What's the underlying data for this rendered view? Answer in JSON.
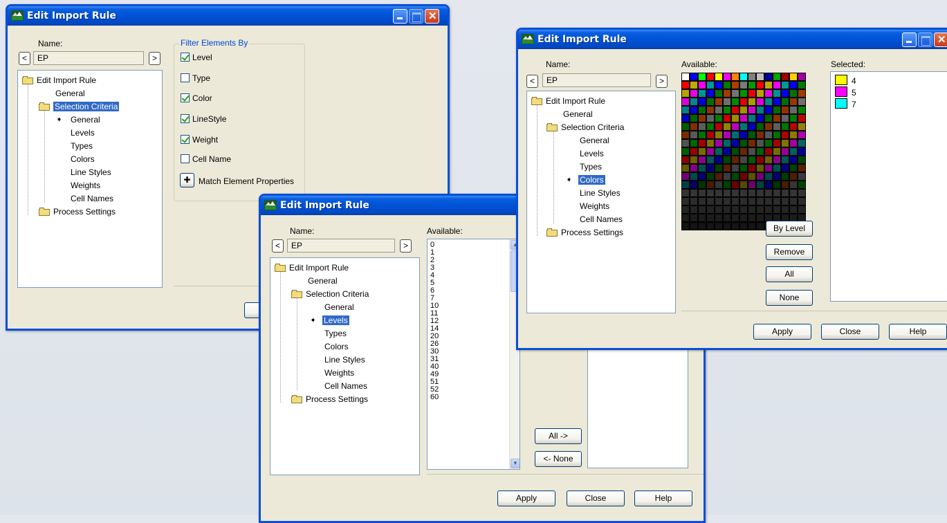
{
  "colors": {
    "accent": "#316ac5",
    "titlebar": "#0052d6",
    "dialog_bg": "#ece9d8"
  },
  "window1": {
    "title": "Edit Import Rule",
    "name_label": "Name:",
    "name_value": "EP",
    "prev": "<",
    "next": ">",
    "tree": {
      "root": "Edit Import Rule",
      "general": "General",
      "selection": "Selection Criteria",
      "children": [
        "General",
        "Levels",
        "Types",
        "Colors",
        "Line Styles",
        "Weights",
        "Cell Names"
      ],
      "process": "Process Settings"
    },
    "filter_title": "Filter Elements By",
    "filters": [
      {
        "label": "Level",
        "checked": true
      },
      {
        "label": "Type",
        "checked": false
      },
      {
        "label": "Color",
        "checked": true
      },
      {
        "label": "LineStyle",
        "checked": true
      },
      {
        "label": "Weight",
        "checked": true
      },
      {
        "label": "Cell Name",
        "checked": false
      }
    ],
    "match_label": "Match Element Properties"
  },
  "window2": {
    "title": "Edit Import Rule",
    "name_label": "Name:",
    "name_value": "EP",
    "prev": "<",
    "next": ">",
    "tree": {
      "root": "Edit Import Rule",
      "general": "General",
      "selection": "Selection Criteria",
      "children": [
        "General",
        "Levels",
        "Types",
        "Colors",
        "Line Styles",
        "Weights",
        "Cell Names"
      ],
      "process": "Process Settings"
    },
    "available_label": "Available:",
    "levels": [
      "0",
      "1",
      "2",
      "3",
      "4",
      "5",
      "6",
      "7",
      "10",
      "11",
      "12",
      "14",
      "20",
      "26",
      "30",
      "31",
      "40",
      "49",
      "51",
      "52",
      "60"
    ],
    "all_btn": "All ->",
    "none_btn": "<- None",
    "apply": "Apply",
    "close": "Close",
    "help": "Help"
  },
  "window3": {
    "title": "Edit Import Rule",
    "name_label": "Name:",
    "name_value": "EP",
    "prev": "<",
    "next": ">",
    "tree": {
      "root": "Edit Import Rule",
      "general": "General",
      "selection": "Selection Criteria",
      "children": [
        "General",
        "Levels",
        "Types",
        "Colors",
        "Line Styles",
        "Weights",
        "Cell Names"
      ],
      "process": "Process Settings"
    },
    "available_label": "Available:",
    "selected_label": "Selected:",
    "selected": [
      {
        "value": "4",
        "color": "#ffff00"
      },
      {
        "value": "5",
        "color": "#ff00ff"
      },
      {
        "value": "7",
        "color": "#00ffff"
      }
    ],
    "by_level": "By Level",
    "remove": "Remove",
    "all": "All",
    "none": "None",
    "apply": "Apply",
    "close": "Close",
    "help": "Help"
  }
}
